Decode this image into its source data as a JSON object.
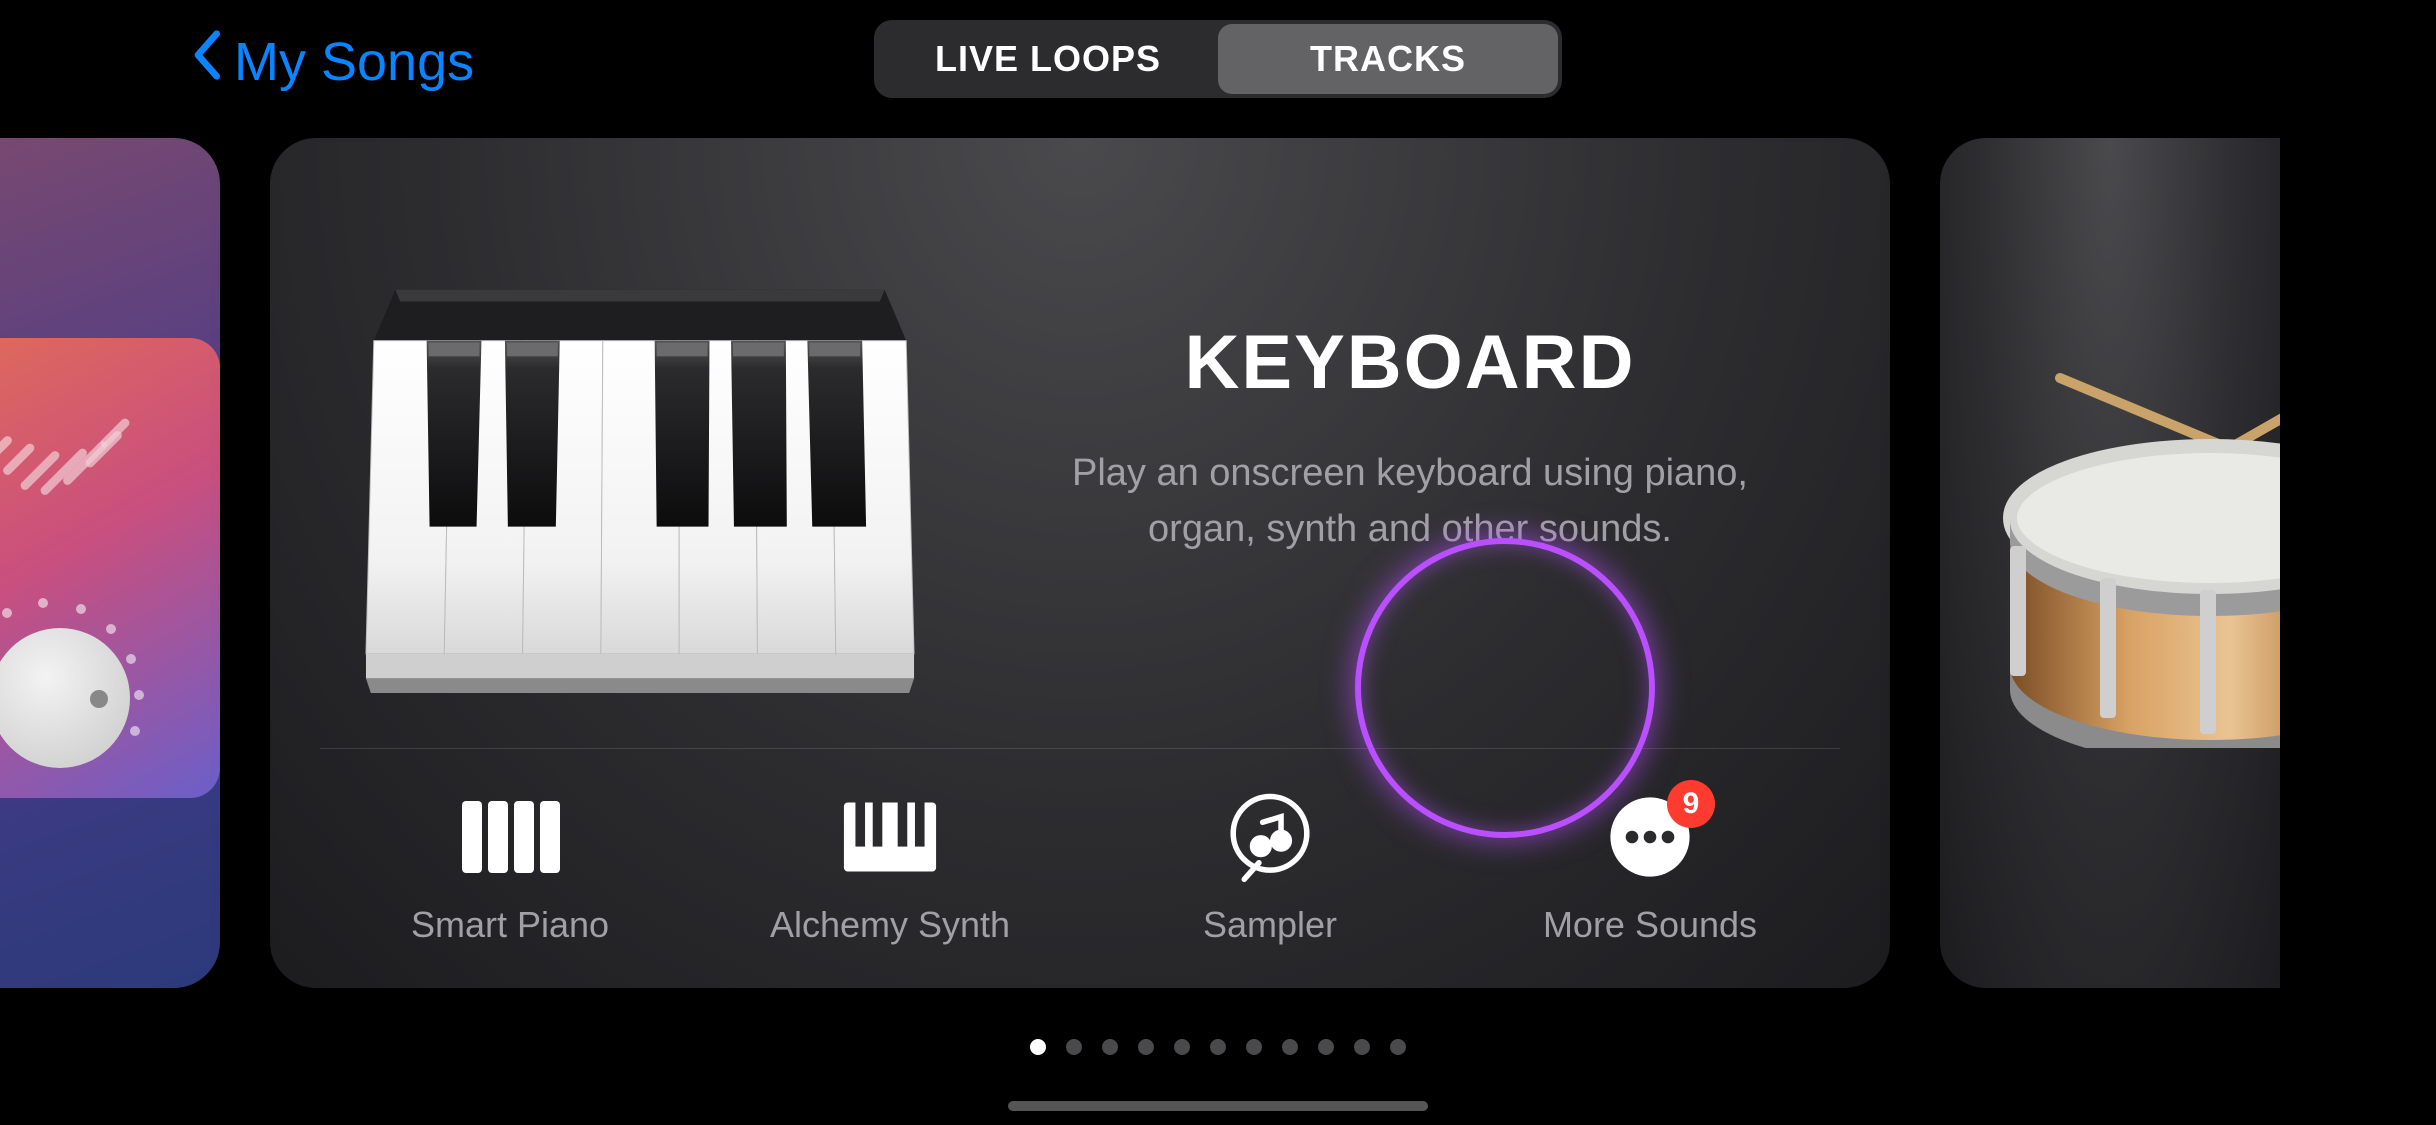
{
  "nav": {
    "back_label": "My Songs",
    "segments": [
      "LIVE LOOPS",
      "TRACKS"
    ],
    "active_segment": 1
  },
  "instrument": {
    "title": "KEYBOARD",
    "description": "Play an onscreen keyboard using piano, organ, synth and other sounds."
  },
  "sub_options": [
    {
      "label": "Smart Piano"
    },
    {
      "label": "Alchemy Synth"
    },
    {
      "label": "Sampler"
    },
    {
      "label": "More Sounds",
      "badge": "9"
    }
  ],
  "pagination": {
    "count": 11,
    "active": 0
  }
}
